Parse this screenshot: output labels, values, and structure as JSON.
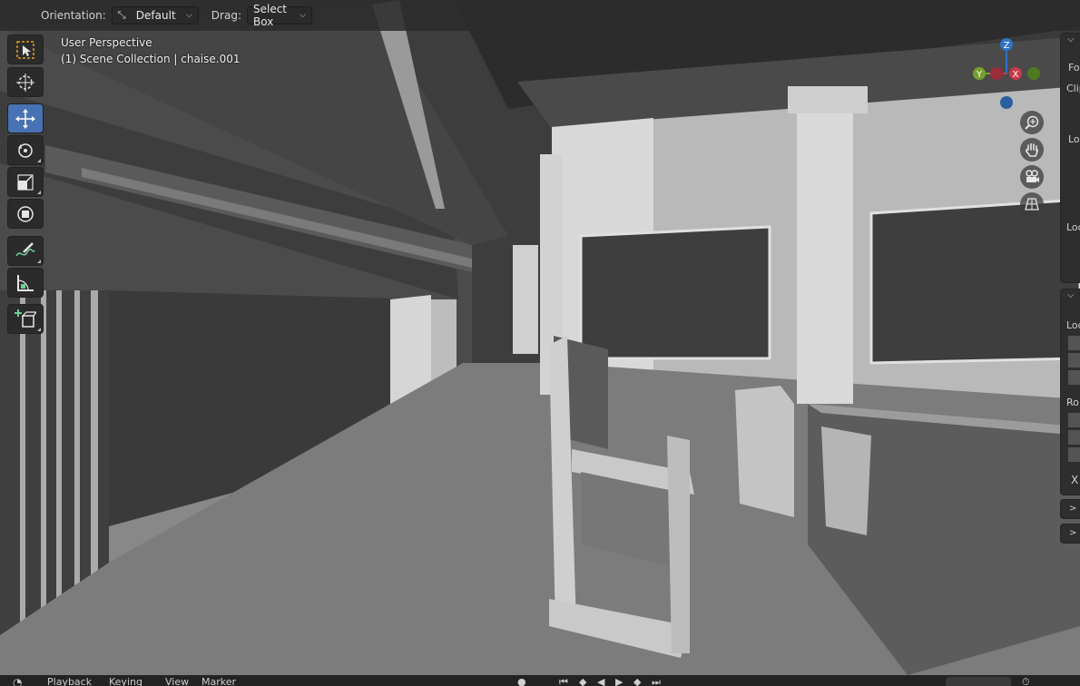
{
  "header": {
    "orientation_label": "Orientation:",
    "orientation_value": "Default",
    "drag_label": "Drag:",
    "drag_value": "Select Box"
  },
  "viewport": {
    "view_name": "User Perspective",
    "collection_info": "(1) Scene Collection | chaise.001"
  },
  "toolbar": {
    "tools": [
      {
        "name": "select-box-tool",
        "icon": "select-box-icon",
        "active": false
      },
      {
        "name": "cursor-tool",
        "icon": "cursor-icon",
        "active": false
      },
      {
        "name": "move-tool",
        "icon": "move-icon",
        "active": true
      },
      {
        "name": "rotate-tool",
        "icon": "rotate-icon",
        "active": false
      },
      {
        "name": "scale-tool",
        "icon": "scale-icon",
        "active": false
      },
      {
        "name": "transform-tool",
        "icon": "transform-icon",
        "active": false
      },
      {
        "name": "annotate-tool",
        "icon": "annotate-icon",
        "active": false
      },
      {
        "name": "measure-tool",
        "icon": "measure-icon",
        "active": false
      },
      {
        "name": "add-cube-tool",
        "icon": "add-cube-icon",
        "active": false
      }
    ],
    "active_color": "#4772b3"
  },
  "gizmo": {
    "z_label": "Z",
    "y_label": "Y",
    "x_label": "X",
    "x_color": "#c8394a",
    "y_color": "#76a02c",
    "z_color": "#2f73c8"
  },
  "sidebar": {
    "labels": [
      "Fo",
      "Clip",
      "Lo",
      "Loc",
      "Loc",
      "Ro",
      "X"
    ]
  },
  "bottombar": {
    "playback": "Playback",
    "keying": "Keying",
    "view": "View",
    "marker": "Marker"
  }
}
